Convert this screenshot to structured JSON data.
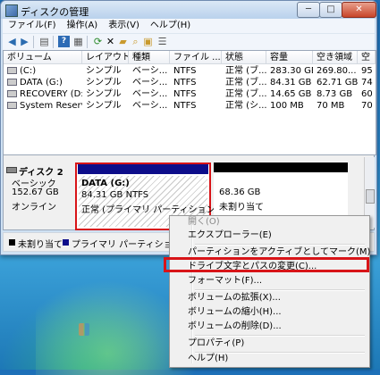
{
  "window": {
    "title": "ディスクの管理",
    "min": "─",
    "max": "□",
    "close": "✕"
  },
  "menu": [
    "ファイル(F)",
    "操作(A)",
    "表示(V)",
    "ヘルプ(H)"
  ],
  "toolbar_icons": [
    "back-icon",
    "forward-icon",
    "console-icon",
    "help-icon",
    "properties-icon",
    "refresh-icon",
    "delete-icon",
    "open-icon",
    "search-icon",
    "export-icon",
    "list-icon"
  ],
  "columns": [
    "ボリューム",
    "レイアウト",
    "種類",
    "ファイル ...",
    "状態",
    "容量",
    "空き領域",
    "空"
  ],
  "volumes": [
    [
      "(C:)",
      "シンプル",
      "ベーシ...",
      "NTFS",
      "正常 (ブ...",
      "283.30 GB",
      "269.80...",
      "95"
    ],
    [
      "DATA (G:)",
      "シンプル",
      "ベーシ...",
      "NTFS",
      "正常 (ブ...",
      "84.31 GB",
      "62.71 GB",
      "74"
    ],
    [
      "RECOVERY (D:)",
      "シンプル",
      "ベーシ...",
      "NTFS",
      "正常 (ブ...",
      "14.65 GB",
      "8.73 GB",
      "60"
    ],
    [
      "System Reserved",
      "シンプル",
      "ベーシ...",
      "NTFS",
      "正常 (シ...",
      "100 MB",
      "70 MB",
      "70"
    ]
  ],
  "disk": {
    "name": "ディスク 2",
    "type": "ベーシック",
    "size": "152.67 GB",
    "status": "オンライン"
  },
  "partition": {
    "name": "DATA (G:)",
    "size_fs": "84.31 GB NTFS",
    "status": "正常 (プライマリ パーティション)"
  },
  "unallocated": {
    "size": "68.36 GB",
    "label": "未割り当て"
  },
  "legend": {
    "unallocated": "未割り当て",
    "primary": "プライマリ パーティション"
  },
  "context_menu": {
    "open": "開く(O)",
    "explorer": "エクスプローラー(E)",
    "mark_active": "パーティションをアクティブとしてマーク(M)",
    "change_letter": "ドライブ文字とパスの変更(C)...",
    "format": "フォーマット(F)...",
    "extend": "ボリュームの拡張(X)...",
    "shrink": "ボリュームの縮小(H)...",
    "delete": "ボリュームの削除(D)...",
    "properties": "プロパティ(P)",
    "help": "ヘルプ(H)"
  }
}
